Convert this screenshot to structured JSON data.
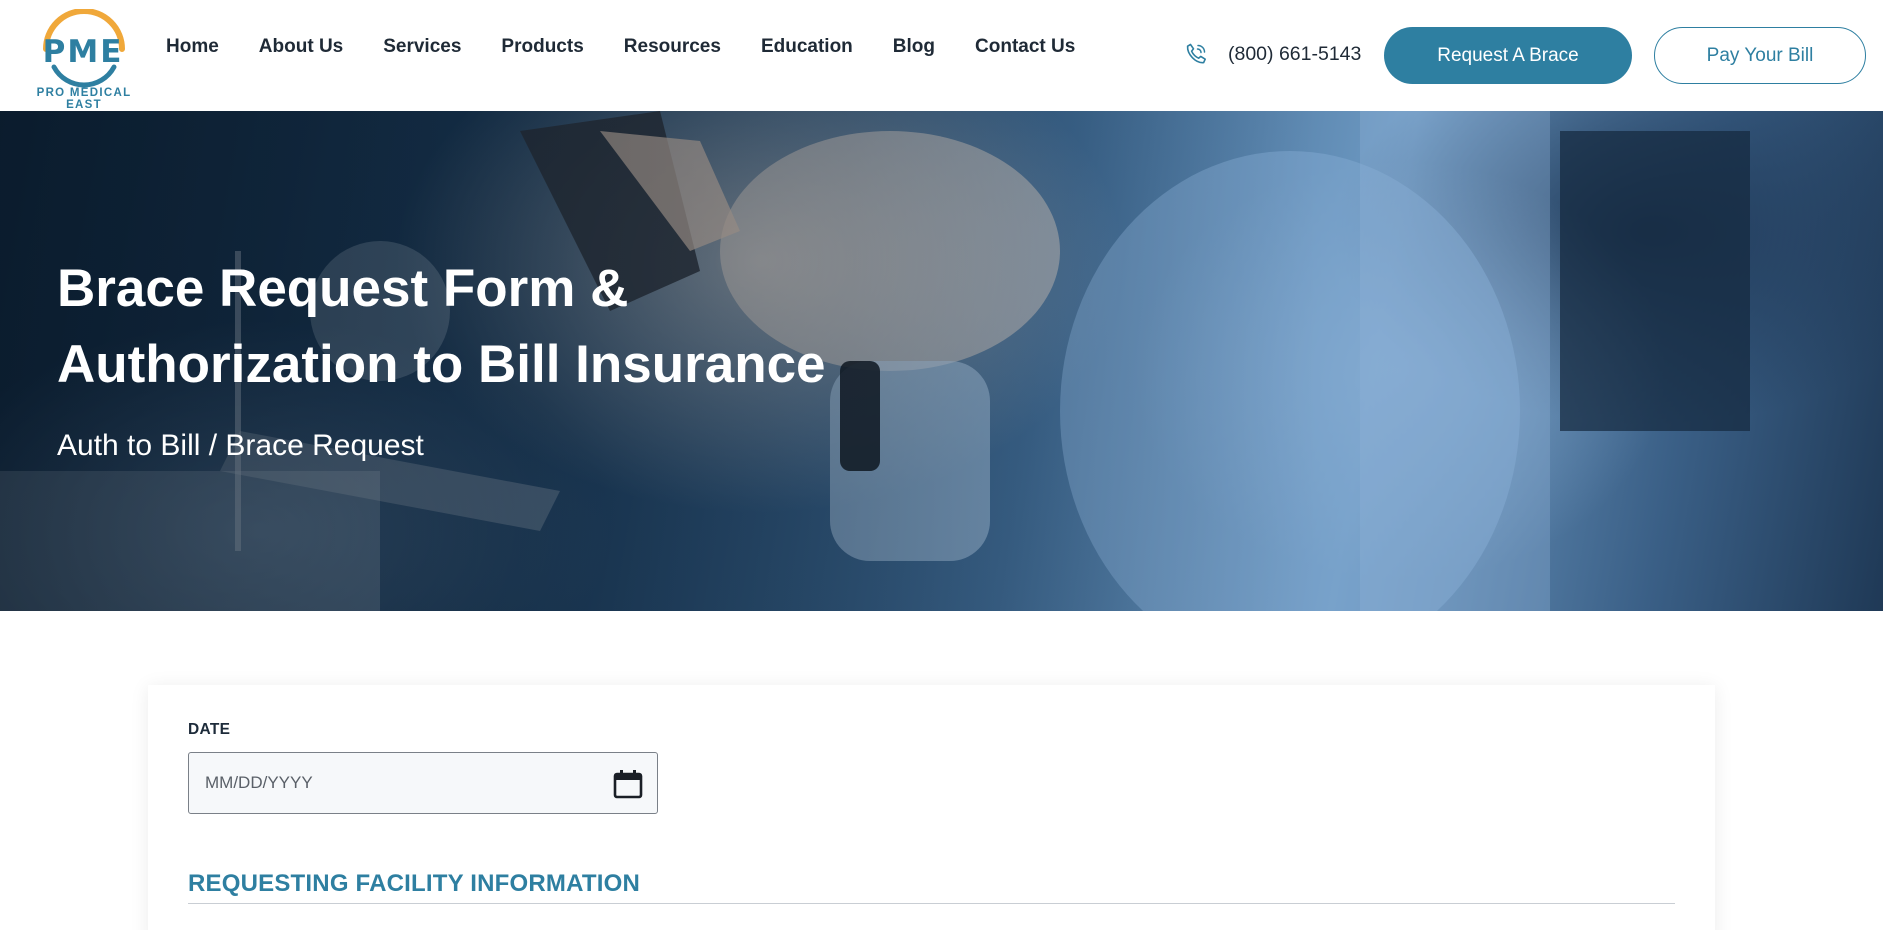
{
  "header": {
    "logo": {
      "mark": "PME",
      "tagline": "PRO MEDICAL EAST"
    },
    "nav": [
      "Home",
      "About Us",
      "Services",
      "Products",
      "Resources",
      "Education",
      "Blog",
      "Contact Us"
    ],
    "phone": "(800) 661-5143",
    "request_brace_label": "Request A Brace",
    "pay_bill_label": "Pay Your Bill"
  },
  "hero": {
    "title_line1": "Brace Request Form &",
    "title_line2": "Authorization to Bill Insurance",
    "subtitle": "Auth to Bill / Brace Request"
  },
  "form": {
    "date_label": "DATE",
    "date_placeholder": "MM/DD/YYYY",
    "section_title": "REQUESTING FACILITY INFORMATION"
  },
  "colors": {
    "accent": "#2e7fa1",
    "logo_orange": "#f0a83a",
    "text": "#1f2a36"
  }
}
